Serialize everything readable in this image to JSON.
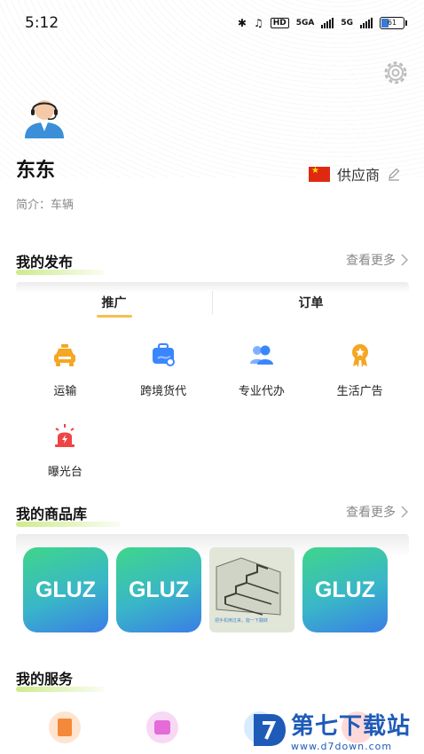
{
  "status": {
    "time": "5:12",
    "net1": "5GA",
    "net2": "5G",
    "hd": "HD",
    "battery": "61"
  },
  "profile": {
    "name": "东东",
    "role": "供应商",
    "intro": "简介：车辆"
  },
  "publish": {
    "title": "我的发布",
    "more": "查看更多",
    "tabs": [
      "推广",
      "订单"
    ],
    "services": [
      {
        "label": "运输",
        "icon": "taxi-icon",
        "color": "#f5a623"
      },
      {
        "label": "跨境货代",
        "icon": "briefcase-icon",
        "color": "#3a86ff"
      },
      {
        "label": "专业代办",
        "icon": "users-icon",
        "color": "#3a86ff"
      },
      {
        "label": "生活广告",
        "icon": "badge-icon",
        "color": "#f5a623"
      },
      {
        "label": "曝光台",
        "icon": "siren-icon",
        "color": "#ef4444"
      }
    ]
  },
  "goods": {
    "title": "我的商品库",
    "more": "查看更多",
    "items": [
      "GLUZ",
      "GLUZ",
      "",
      "GLUZ"
    ],
    "stairs_caption": "把手机倒过来，能一下翻转"
  },
  "myservice": {
    "title": "我的服务"
  },
  "watermark": {
    "title": "第七下载站",
    "url": "www.d7down.com"
  }
}
